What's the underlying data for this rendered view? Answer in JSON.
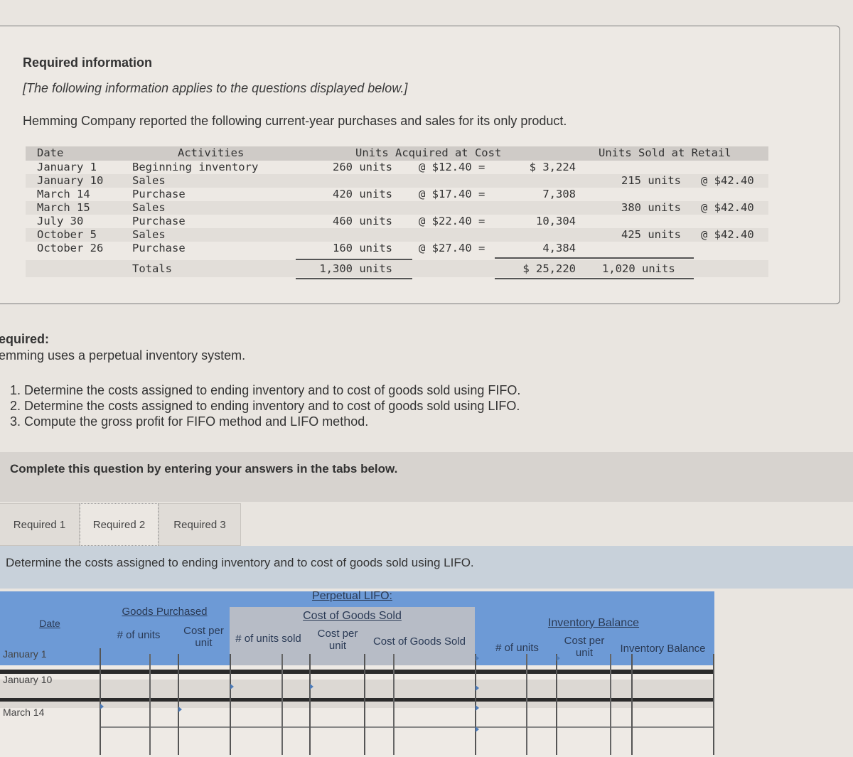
{
  "header": {
    "title": "Required information",
    "note": "[The following information applies to the questions displayed below.]",
    "intro": "Hemming Company reported the following current-year purchases and sales for its only product."
  },
  "inventory_table": {
    "headers": {
      "date": "Date",
      "activities": "Activities",
      "acquired": "Units Acquired at Cost",
      "sold": "Units Sold at Retail"
    },
    "rows": [
      {
        "date": "January 1",
        "activity": "Beginning inventory",
        "units_acq": "260 units",
        "unit_cost": "@ $12.40 =",
        "total_cost": "$ 3,224",
        "units_sold": "",
        "retail": ""
      },
      {
        "date": "January 10",
        "activity": "Sales",
        "units_acq": "",
        "unit_cost": "",
        "total_cost": "",
        "units_sold": "215 units",
        "retail": "@ $42.40"
      },
      {
        "date": "March 14",
        "activity": "Purchase",
        "units_acq": "420 units",
        "unit_cost": "@ $17.40 =",
        "total_cost": "7,308",
        "units_sold": "",
        "retail": ""
      },
      {
        "date": "March 15",
        "activity": "Sales",
        "units_acq": "",
        "unit_cost": "",
        "total_cost": "",
        "units_sold": "380 units",
        "retail": "@ $42.40"
      },
      {
        "date": "July 30",
        "activity": "Purchase",
        "units_acq": "460 units",
        "unit_cost": "@ $22.40 =",
        "total_cost": "10,304",
        "units_sold": "",
        "retail": ""
      },
      {
        "date": "October 5",
        "activity": "Sales",
        "units_acq": "",
        "unit_cost": "",
        "total_cost": "",
        "units_sold": "425 units",
        "retail": "@ $42.40"
      },
      {
        "date": "October 26",
        "activity": "Purchase",
        "units_acq": "160 units",
        "unit_cost": "@ $27.40 =",
        "total_cost": "4,384",
        "units_sold": "",
        "retail": ""
      }
    ],
    "totals": {
      "label": "Totals",
      "units_acq": "1,300 units",
      "total_cost": "$ 25,220",
      "units_sold": "1,020 units"
    }
  },
  "required": {
    "heading": "equired:",
    "subtext": "emming uses a perpetual inventory system.",
    "tasks": [
      "1. Determine the costs assigned to ending inventory and to cost of goods sold using FIFO.",
      "2. Determine the costs assigned to ending inventory and to cost of goods sold using LIFO.",
      "3. Compute the gross profit for FIFO method and LIFO method."
    ]
  },
  "instructions": "Complete this question by entering your answers in the tabs below.",
  "tabs": [
    {
      "label": "Required 1",
      "active": false
    },
    {
      "label": "Required 2",
      "active": true
    },
    {
      "label": "Required 3",
      "active": false
    }
  ],
  "tab_prompt": "Determine the costs assigned to ending inventory and to cost of goods sold using LIFO.",
  "answer_grid": {
    "title": "Perpetual LIFO:",
    "date_header": "Date",
    "goods_purchased": {
      "title": "Goods Purchased",
      "cols": [
        "# of units",
        "Cost per unit"
      ]
    },
    "cogs": {
      "title": "Cost of Goods Sold",
      "cols": [
        "# of units sold",
        "Cost per unit",
        "Cost of Goods Sold"
      ]
    },
    "inventory_balance": {
      "title": "Inventory Balance",
      "cols": [
        "# of units",
        "Cost per unit",
        "Inventory Balance"
      ]
    },
    "rows": [
      "January 1",
      "January 10",
      "March 14"
    ]
  }
}
